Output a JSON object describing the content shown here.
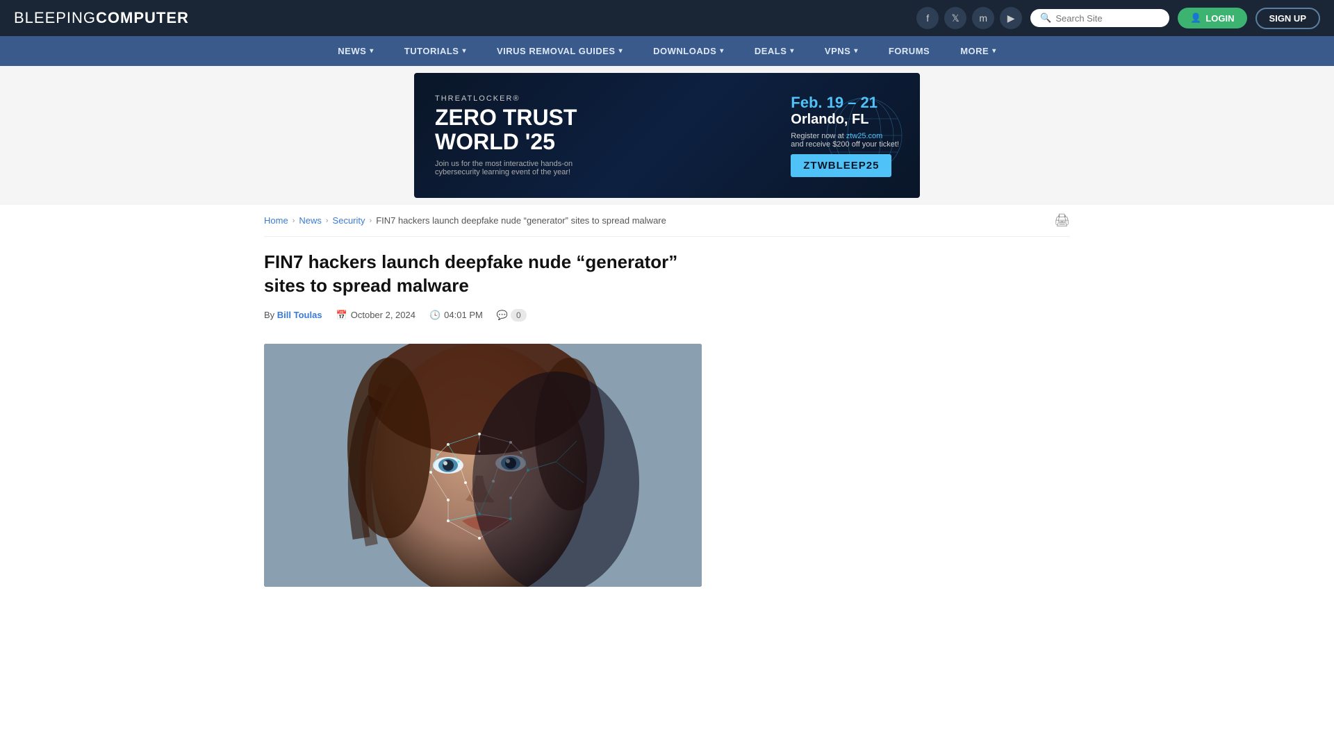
{
  "header": {
    "logo_text": "BLEEPING",
    "logo_bold": "COMPUTER",
    "search_placeholder": "Search Site",
    "btn_login": "LOGIN",
    "btn_signup": "SIGN UP"
  },
  "nav": {
    "items": [
      {
        "label": "NEWS",
        "has_dropdown": true
      },
      {
        "label": "TUTORIALS",
        "has_dropdown": true
      },
      {
        "label": "VIRUS REMOVAL GUIDES",
        "has_dropdown": true
      },
      {
        "label": "DOWNLOADS",
        "has_dropdown": true
      },
      {
        "label": "DEALS",
        "has_dropdown": true
      },
      {
        "label": "VPNS",
        "has_dropdown": true
      },
      {
        "label": "FORUMS",
        "has_dropdown": false
      },
      {
        "label": "MORE",
        "has_dropdown": true
      }
    ]
  },
  "ad": {
    "brand": "THREATLOCKER®",
    "title_line1": "ZERO TRUST",
    "title_line2": "WORLD '25",
    "subtitle": "Join us for the most interactive hands-on\ncybersecurity learning event of the year!",
    "date": "Feb. 19 – 21",
    "location": "Orlando, FL",
    "register_text": "Register now at",
    "register_url": "ztw25.com",
    "discount": "and receive $200 off your ticket!",
    "promo_code": "ZTWBLEEP25"
  },
  "breadcrumb": {
    "home": "Home",
    "news": "News",
    "security": "Security",
    "current": "FIN7 hackers launch deepfake nude “generator” sites to spread malware"
  },
  "article": {
    "title": "FIN7 hackers launch deepfake nude “generator” sites to spread malware",
    "author": "Bill Toulas",
    "by_label": "By",
    "date": "October 2, 2024",
    "time": "04:01 PM",
    "comments": "0"
  },
  "colors": {
    "header_bg": "#1a2535",
    "nav_bg": "#3a5a8c",
    "link_blue": "#3a7bd5",
    "green": "#3cb371"
  }
}
